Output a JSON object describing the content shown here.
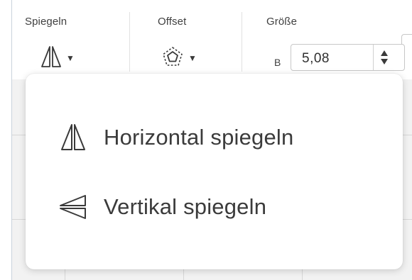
{
  "toolbar": {
    "mirror": {
      "label": "Spiegeln",
      "icon": "mirror-icon"
    },
    "offset": {
      "label": "Offset",
      "icon": "offset-icon"
    },
    "size": {
      "label": "Größe",
      "width_prefix": "B",
      "width_value": "5,08"
    }
  },
  "dropdown": {
    "items": [
      {
        "label": "Horizontal spiegeln",
        "icon": "flip-horizontal-icon"
      },
      {
        "label": "Vertikal spiegeln",
        "icon": "flip-vertical-icon"
      }
    ]
  },
  "colors": {
    "icon_stroke": "#3a3a3a",
    "text": "#3b3b3b",
    "border": "#c7c7c7"
  }
}
